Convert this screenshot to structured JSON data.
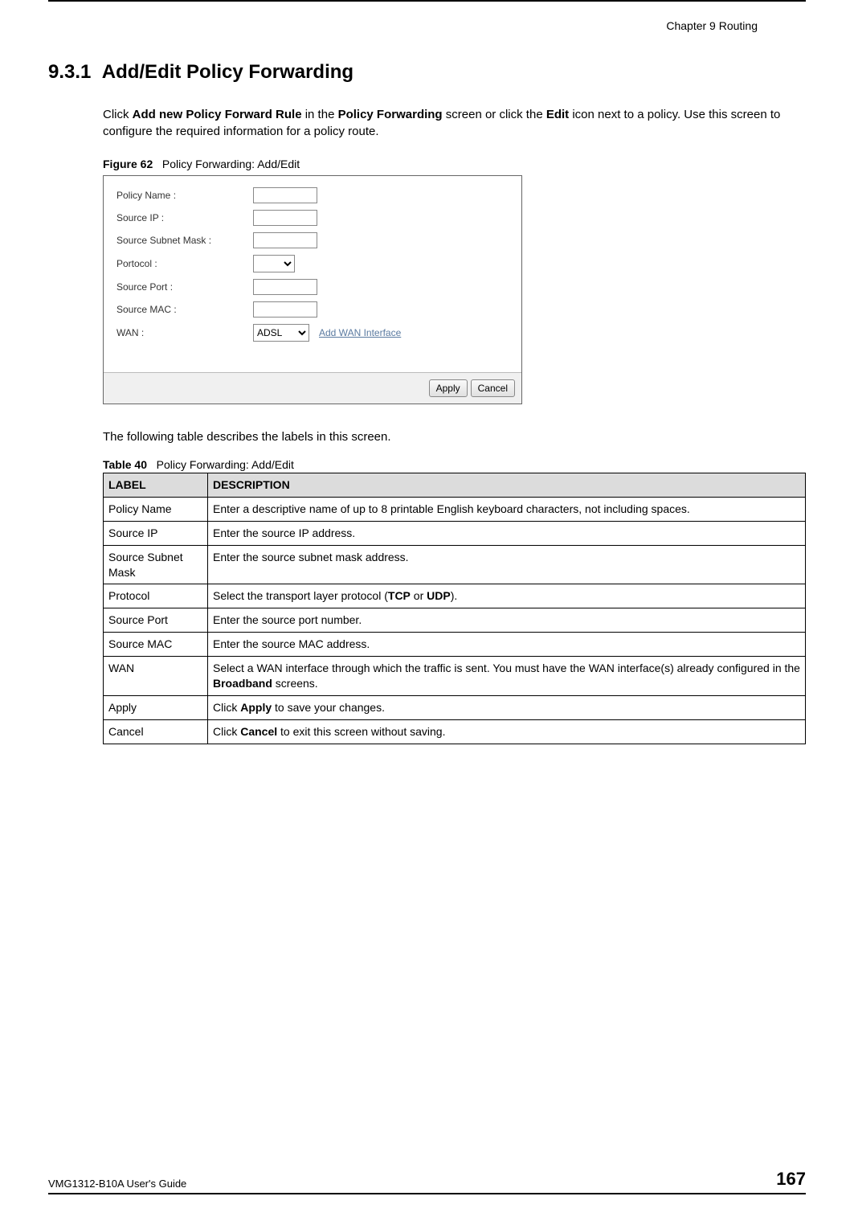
{
  "header": {
    "chapter": "Chapter 9 Routing"
  },
  "section": {
    "number": "9.3.1",
    "title": "Add/Edit Policy Forwarding"
  },
  "intro": {
    "t1": "Click ",
    "b1": "Add new Policy Forward Rule",
    "t2": " in the ",
    "b2": "Policy Forwarding",
    "t3": " screen or click the ",
    "b3": "Edit",
    "t4": " icon next to a policy. Use this screen to configure the required information for a policy route."
  },
  "figure": {
    "label": "Figure 62",
    "caption": "Policy Forwarding: Add/Edit",
    "form": {
      "policy_name_label": "Policy Name :",
      "source_ip_label": "Source IP :",
      "source_subnet_label": "Source Subnet Mask :",
      "protocol_label": "Portocol :",
      "source_port_label": "Source Port :",
      "source_mac_label": "Source MAC :",
      "wan_label": "WAN :",
      "protocol_value": "",
      "wan_value": "ADSL",
      "add_wan_link": "Add WAN Interface",
      "apply_button": "Apply",
      "cancel_button": "Cancel"
    }
  },
  "post_figure_para": "The following table describes the labels in this screen.",
  "table": {
    "label": "Table 40",
    "caption": "Policy Forwarding: Add/Edit",
    "header_label": "LABEL",
    "header_desc": "DESCRIPTION",
    "rows": [
      {
        "label": "Policy Name",
        "desc_plain": "Enter a descriptive name of up to 8 printable English keyboard characters, not including spaces."
      },
      {
        "label": "Source IP",
        "desc_plain": "Enter the source IP address."
      },
      {
        "label": "Source Subnet Mask",
        "desc_plain": "Enter the source subnet mask address."
      },
      {
        "label": "Protocol",
        "desc_pre": "Select the transport layer protocol (",
        "desc_b1": "TCP",
        "desc_mid": " or ",
        "desc_b2": "UDP",
        "desc_post": ")."
      },
      {
        "label": "Source Port",
        "desc_plain": "Enter the source port number."
      },
      {
        "label": "Source MAC",
        "desc_plain": "Enter the source MAC address."
      },
      {
        "label": "WAN",
        "desc_pre": "Select a WAN interface through which the traffic is sent. You must have the WAN interface(s) already configured in the ",
        "desc_b1": "Broadband",
        "desc_post": " screens."
      },
      {
        "label": "Apply",
        "desc_pre": "Click ",
        "desc_b1": "Apply",
        "desc_post": " to save your changes."
      },
      {
        "label": "Cancel",
        "desc_pre": "Click ",
        "desc_b1": "Cancel",
        "desc_post": " to exit this screen without saving."
      }
    ]
  },
  "footer": {
    "guide": "VMG1312-B10A User's Guide",
    "page": "167"
  }
}
